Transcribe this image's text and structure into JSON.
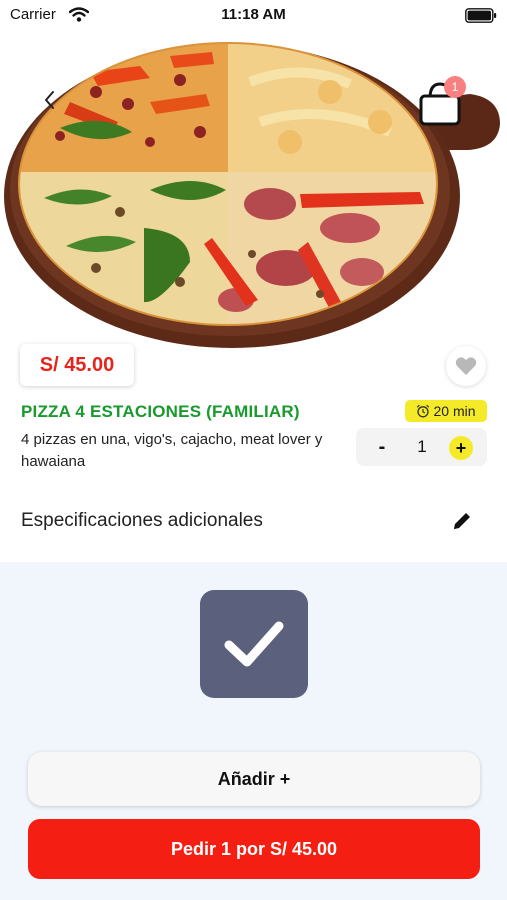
{
  "status_bar": {
    "carrier": "Carrier",
    "time": "11:18 AM"
  },
  "header": {
    "back_icon": "chevron-left-icon",
    "cart_icon": "shopping-bag-icon",
    "cart_count": "1"
  },
  "product": {
    "image": "pizza-image",
    "price": "S/ 45.00",
    "name": "PIZZA 4 ESTACIONES (FAMILIAR)",
    "description": "4 pizzas en una, vigo's, cajacho, meat lover y hawaiana",
    "prep_time": "20 min",
    "favorite_icon": "heart-icon"
  },
  "quantity": {
    "minus_label": "-",
    "value": "1",
    "plus_label": "+"
  },
  "specs": {
    "label": "Especificaciones adicionales",
    "edit_icon": "pencil-icon"
  },
  "actions": {
    "check_icon": "checkmark-icon",
    "add_label": "Añadir +",
    "order_label": "Pedir 1 por S/ 45.00"
  },
  "colors": {
    "price_red": "#e5251b",
    "name_green": "#1a9a2e",
    "accent_yellow": "#f5ea27",
    "order_red": "#f51e12",
    "check_tile": "#5b617d",
    "badge_pink": "#f98080"
  }
}
